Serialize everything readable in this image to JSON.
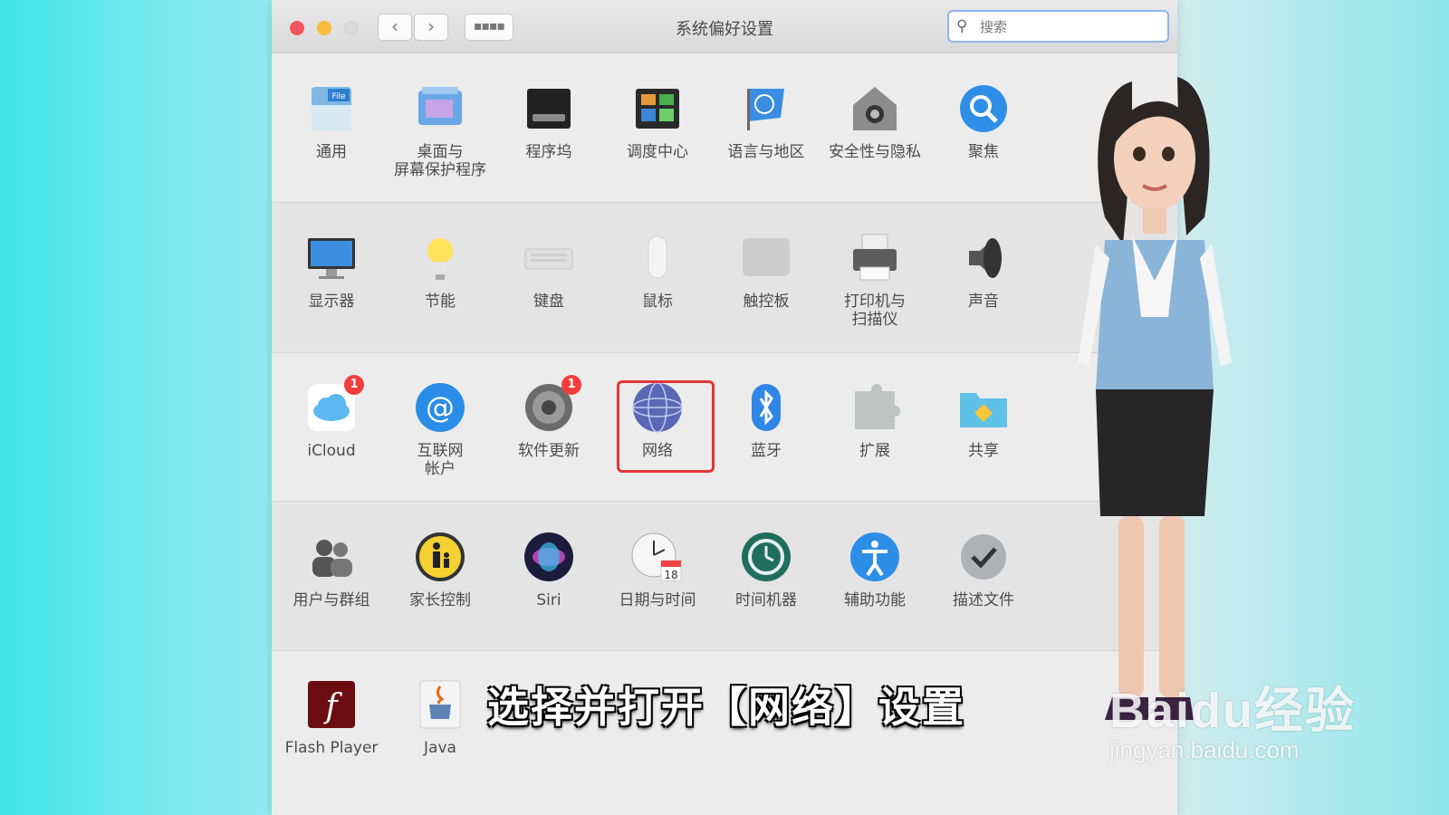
{
  "window": {
    "title": "系统偏好设置",
    "search_placeholder": "搜索"
  },
  "rows": [
    {
      "items": [
        {
          "id": "general",
          "label": "通用",
          "icon": "general-icon"
        },
        {
          "id": "desktop",
          "label": "桌面与\n屏幕保护程序",
          "icon": "desktop-icon"
        },
        {
          "id": "dock",
          "label": "程序坞",
          "icon": "dock-icon"
        },
        {
          "id": "mission",
          "label": "调度中心",
          "icon": "mission-control-icon"
        },
        {
          "id": "language",
          "label": "语言与地区",
          "icon": "language-flag-icon"
        },
        {
          "id": "security",
          "label": "安全性与隐私",
          "icon": "security-house-icon"
        },
        {
          "id": "spotlight",
          "label": "聚焦",
          "icon": "spotlight-icon"
        }
      ]
    },
    {
      "items": [
        {
          "id": "displays",
          "label": "显示器",
          "icon": "display-icon"
        },
        {
          "id": "energy",
          "label": "节能",
          "icon": "lightbulb-icon"
        },
        {
          "id": "keyboard",
          "label": "键盘",
          "icon": "keyboard-icon"
        },
        {
          "id": "mouse",
          "label": "鼠标",
          "icon": "mouse-icon"
        },
        {
          "id": "trackpad",
          "label": "触控板",
          "icon": "trackpad-icon"
        },
        {
          "id": "printers",
          "label": "打印机与\n扫描仪",
          "icon": "printer-icon"
        },
        {
          "id": "sound",
          "label": "声音",
          "icon": "speaker-icon"
        }
      ]
    },
    {
      "items": [
        {
          "id": "icloud",
          "label": "iCloud",
          "icon": "icloud-icon",
          "badge": "1"
        },
        {
          "id": "internet",
          "label": "互联网\n帐户",
          "icon": "at-sign-icon"
        },
        {
          "id": "update",
          "label": "软件更新",
          "icon": "software-update-gear-icon",
          "badge": "1"
        },
        {
          "id": "network",
          "label": "网络",
          "icon": "network-globe-icon"
        },
        {
          "id": "bluetooth",
          "label": "蓝牙",
          "icon": "bluetooth-icon"
        },
        {
          "id": "extensions",
          "label": "扩展",
          "icon": "puzzle-icon"
        },
        {
          "id": "sharing",
          "label": "共享",
          "icon": "sharing-folder-icon"
        }
      ]
    },
    {
      "items": [
        {
          "id": "users",
          "label": "用户与群组",
          "icon": "users-icon"
        },
        {
          "id": "parental",
          "label": "家长控制",
          "icon": "parental-controls-icon"
        },
        {
          "id": "siri",
          "label": "Siri",
          "icon": "siri-icon"
        },
        {
          "id": "datetime",
          "label": "日期与时间",
          "icon": "clock-calendar-icon"
        },
        {
          "id": "timemachine",
          "label": "时间机器",
          "icon": "time-machine-icon"
        },
        {
          "id": "accessibility",
          "label": "辅助功能",
          "icon": "accessibility-icon"
        },
        {
          "id": "profiles",
          "label": "描述文件",
          "icon": "profiles-badge-icon"
        }
      ]
    },
    {
      "items": [
        {
          "id": "flash",
          "label": "Flash Player",
          "icon": "flash-player-icon"
        },
        {
          "id": "java",
          "label": "Java",
          "icon": "java-cup-icon"
        }
      ]
    }
  ],
  "calendar_day": "18",
  "subtitle": "选择并打开【网络】设置",
  "watermark": {
    "brand": "Baidu经验",
    "site": "jingyan.baidu.com"
  },
  "colors": {
    "highlight": "#e23535",
    "badge": "#f33c3c",
    "search_border": "#8fb4ee"
  }
}
